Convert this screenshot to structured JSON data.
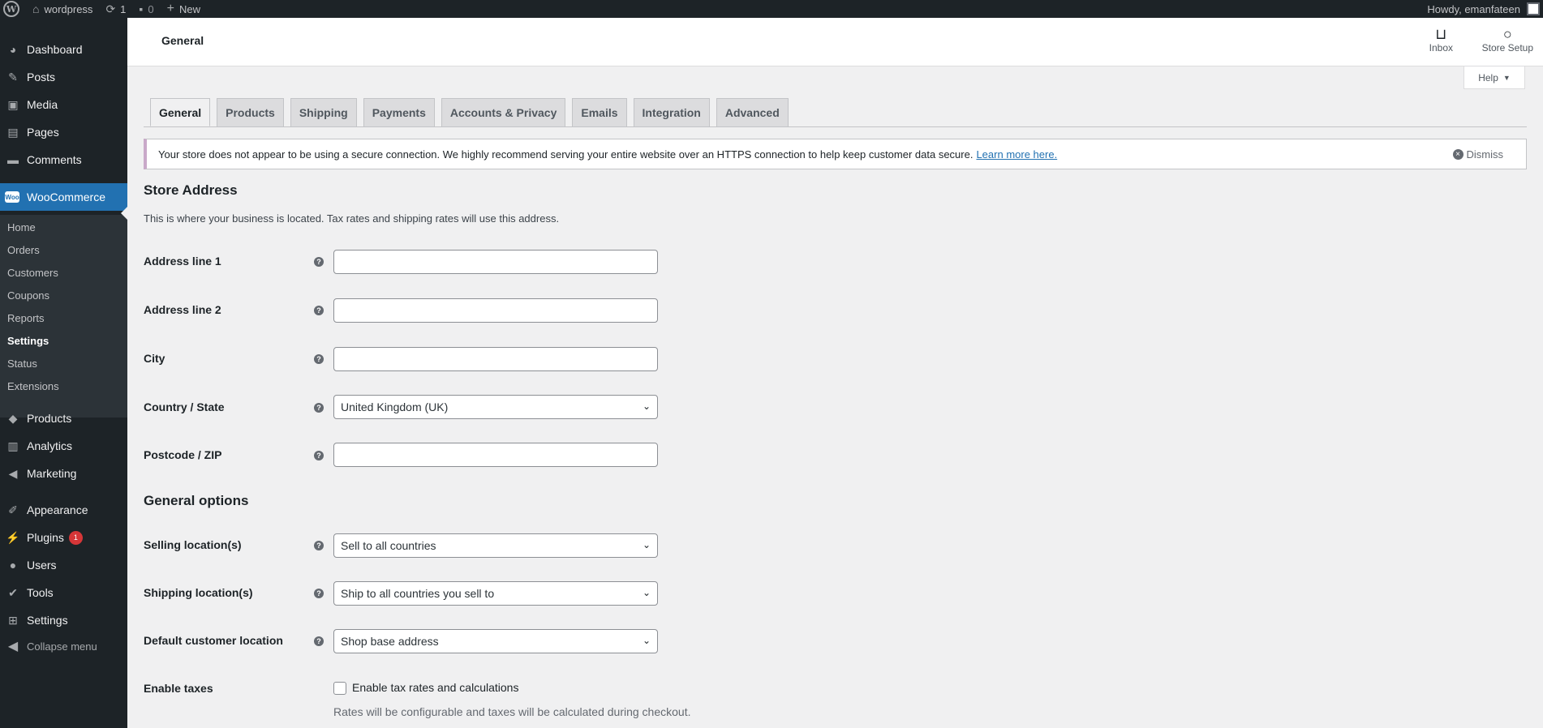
{
  "admin_bar": {
    "site_name": "wordpress",
    "updates_count": "1",
    "comments_count": "0",
    "new_label": "New",
    "greeting": "Howdy, emanfateen"
  },
  "sidebar": {
    "items": [
      {
        "label": "Dashboard",
        "icon": "dashboard-icon"
      },
      {
        "label": "Posts",
        "icon": "pin-icon"
      },
      {
        "label": "Media",
        "icon": "media-icon"
      },
      {
        "label": "Pages",
        "icon": "pages-icon"
      },
      {
        "label": "Comments",
        "icon": "comment-icon"
      },
      {
        "label": "WooCommerce",
        "icon": "woo-icon"
      },
      {
        "label": "Products",
        "icon": "box-icon"
      },
      {
        "label": "Analytics",
        "icon": "chart-icon"
      },
      {
        "label": "Marketing",
        "icon": "megaphone-icon"
      },
      {
        "label": "Appearance",
        "icon": "brush-icon"
      },
      {
        "label": "Plugins",
        "icon": "plug-icon",
        "badge": "1"
      },
      {
        "label": "Users",
        "icon": "user-icon"
      },
      {
        "label": "Tools",
        "icon": "wrench-icon"
      },
      {
        "label": "Settings",
        "icon": "settings-icon"
      }
    ],
    "woo_badge": "Woo",
    "submenu": [
      "Home",
      "Orders",
      "Customers",
      "Coupons",
      "Reports",
      "Settings",
      "Status",
      "Extensions"
    ],
    "collapse_label": "Collapse menu"
  },
  "header": {
    "title": "General",
    "inbox_label": "Inbox",
    "store_setup_label": "Store Setup",
    "help_label": "Help"
  },
  "tabs": [
    "General",
    "Products",
    "Shipping",
    "Payments",
    "Accounts & Privacy",
    "Emails",
    "Integration",
    "Advanced"
  ],
  "notice": {
    "text": "Your store does not appear to be using a secure connection. We highly recommend serving your entire website over an HTTPS connection to help keep customer data secure.",
    "link": "Learn more here.",
    "dismiss": "Dismiss"
  },
  "store_address": {
    "title": "Store Address",
    "description": "This is where your business is located. Tax rates and shipping rates will use this address.",
    "address1_label": "Address line 1",
    "address1_value": "",
    "address2_label": "Address line 2",
    "address2_value": "",
    "city_label": "City",
    "city_value": "",
    "country_label": "Country / State",
    "country_value": "United Kingdom (UK)",
    "postcode_label": "Postcode / ZIP",
    "postcode_value": ""
  },
  "general_options": {
    "title": "General options",
    "selling_label": "Selling location(s)",
    "selling_value": "Sell to all countries",
    "shipping_label": "Shipping location(s)",
    "shipping_value": "Ship to all countries you sell to",
    "default_customer_label": "Default customer location",
    "default_customer_value": "Shop base address",
    "taxes_label": "Enable taxes",
    "taxes_checkbox_label": "Enable tax rates and calculations",
    "taxes_checked": false,
    "taxes_description": "Rates will be configurable and taxes will be calculated during checkout."
  }
}
